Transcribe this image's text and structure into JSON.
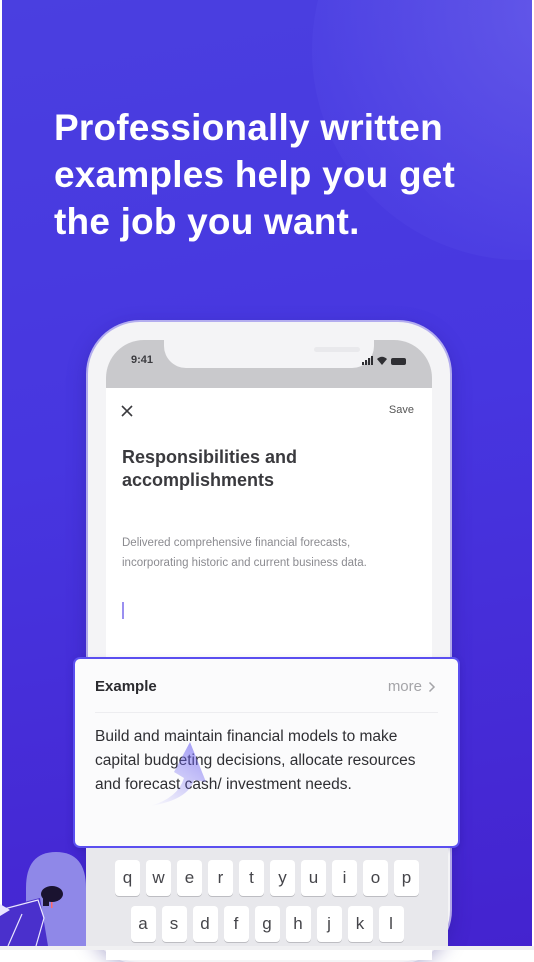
{
  "headline": {
    "lines": [
      "Professionally written",
      "examples help you get",
      "the job you want."
    ]
  },
  "phone": {
    "status_bar": {
      "time": "9:41"
    },
    "nav": {
      "close_icon": "close-icon",
      "save_label": "Save"
    },
    "section_title_lines": [
      "Responsibilities and",
      "accomplishments"
    ],
    "body_text": "Delivered comprehensive financial forecasts, incorporating historic and current business data."
  },
  "example_card": {
    "title": "Example",
    "more_label": "more",
    "more_icon": "chevron-right-icon",
    "text": "Build and maintain financial models to make capital budgeting decisions, allocate resources and forecast cash/ investment needs."
  },
  "keyboard": {
    "rows": [
      [
        "q",
        "w",
        "e",
        "r",
        "t",
        "y",
        "u",
        "i",
        "o",
        "p"
      ],
      [
        "a",
        "s",
        "d",
        "f",
        "g",
        "h",
        "j",
        "k",
        "l"
      ]
    ]
  },
  "colors": {
    "background": "#4736e0",
    "accent": "#5b4ff0",
    "cursor": "#9a8ff0"
  }
}
